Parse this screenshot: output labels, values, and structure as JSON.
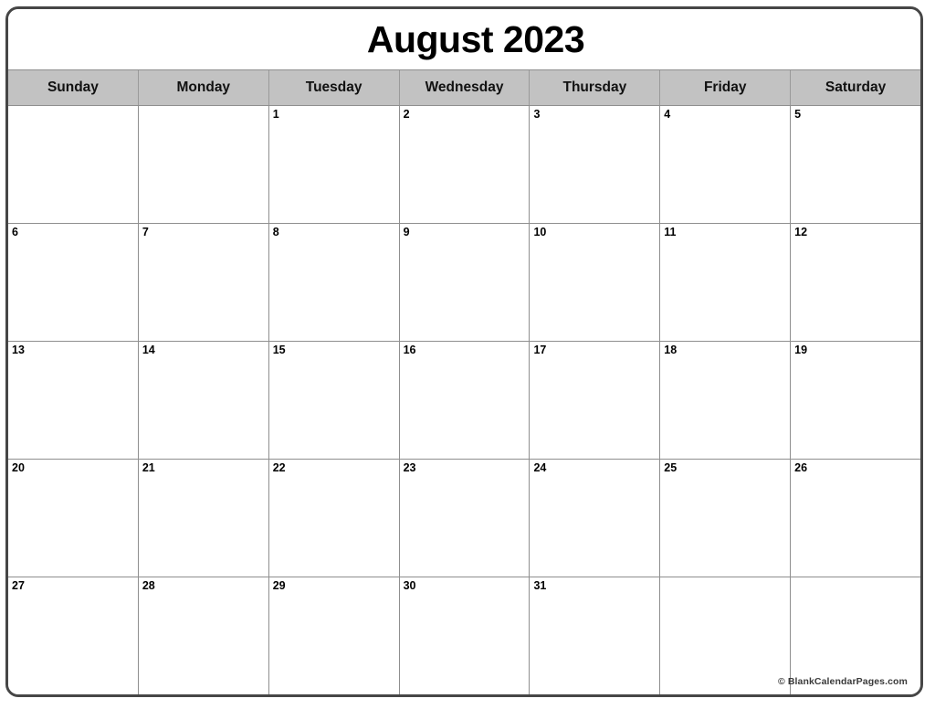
{
  "calendar": {
    "title": "August 2023",
    "month": "August",
    "year": "2023",
    "weekdays": [
      {
        "label": "Sunday"
      },
      {
        "label": "Monday"
      },
      {
        "label": "Tuesday"
      },
      {
        "label": "Wednesday"
      },
      {
        "label": "Thursday"
      },
      {
        "label": "Friday"
      },
      {
        "label": "Saturday"
      }
    ],
    "weeks": [
      [
        {
          "day": ""
        },
        {
          "day": ""
        },
        {
          "day": "1"
        },
        {
          "day": "2"
        },
        {
          "day": "3"
        },
        {
          "day": "4"
        },
        {
          "day": "5"
        }
      ],
      [
        {
          "day": "6"
        },
        {
          "day": "7"
        },
        {
          "day": "8"
        },
        {
          "day": "9"
        },
        {
          "day": "10"
        },
        {
          "day": "11"
        },
        {
          "day": "12"
        }
      ],
      [
        {
          "day": "13"
        },
        {
          "day": "14"
        },
        {
          "day": "15"
        },
        {
          "day": "16"
        },
        {
          "day": "17"
        },
        {
          "day": "18"
        },
        {
          "day": "19"
        }
      ],
      [
        {
          "day": "20"
        },
        {
          "day": "21"
        },
        {
          "day": "22"
        },
        {
          "day": "23"
        },
        {
          "day": "24"
        },
        {
          "day": "25"
        },
        {
          "day": "26"
        }
      ],
      [
        {
          "day": "27"
        },
        {
          "day": "28"
        },
        {
          "day": "29"
        },
        {
          "day": "30"
        },
        {
          "day": "31"
        },
        {
          "day": ""
        },
        {
          "day": ""
        }
      ]
    ],
    "footer": "© BlankCalendarPages.com",
    "colors": {
      "frame_border": "#464646",
      "header_background": "#c2c2c2",
      "grid_line": "#8f8f8f",
      "cell_background": "#ffffff",
      "text": "#000000",
      "footer_text": "#3a3a3a"
    }
  }
}
